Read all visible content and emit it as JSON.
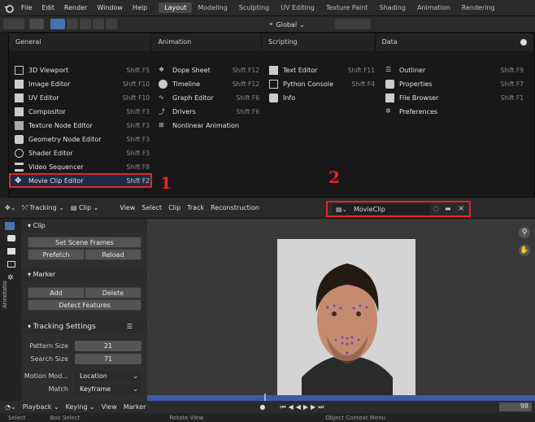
{
  "menubar": {
    "items": [
      "File",
      "Edit",
      "Render",
      "Window",
      "Help"
    ],
    "workspaces": [
      "Layout",
      "Modeling",
      "Sculpting",
      "UV Editing",
      "Texture Paint",
      "Shading",
      "Animation",
      "Rendering"
    ],
    "active_workspace": "Layout"
  },
  "toolbar": {
    "transform_orientation": "Global"
  },
  "editor_menu": {
    "columns": [
      "General",
      "Animation",
      "Scripting",
      "Data"
    ],
    "general": [
      {
        "label": "3D Viewport",
        "shortcut": "Shift F5"
      },
      {
        "label": "Image Editor",
        "shortcut": "Shift F10"
      },
      {
        "label": "UV Editor",
        "shortcut": "Shift F10"
      },
      {
        "label": "Compositor",
        "shortcut": "Shift F3"
      },
      {
        "label": "Texture Node Editor",
        "shortcut": "Shift F3"
      },
      {
        "label": "Geometry Node Editor",
        "shortcut": "Shift F3"
      },
      {
        "label": "Shader Editor",
        "shortcut": "Shift F3"
      },
      {
        "label": "Video Sequencer",
        "shortcut": "Shift F8"
      },
      {
        "label": "Movie Clip Editor",
        "shortcut": "Shift F2"
      }
    ],
    "animation": [
      {
        "label": "Dope Sheet",
        "shortcut": "Shift F12"
      },
      {
        "label": "Timeline",
        "shortcut": "Shift F12"
      },
      {
        "label": "Graph Editor",
        "shortcut": "Shift F6"
      },
      {
        "label": "Drivers",
        "shortcut": "Shift F6"
      },
      {
        "label": "Nonlinear Animation",
        "shortcut": ""
      }
    ],
    "scripting": [
      {
        "label": "Text Editor",
        "shortcut": "Shift F11"
      },
      {
        "label": "Python Console",
        "shortcut": "Shift F4"
      },
      {
        "label": "Info",
        "shortcut": ""
      }
    ],
    "data": [
      {
        "label": "Outliner",
        "shortcut": "Shift F9"
      },
      {
        "label": "Properties",
        "shortcut": "Shift F7"
      },
      {
        "label": "File Browser",
        "shortcut": "Shift F1"
      },
      {
        "label": "Preferences",
        "shortcut": ""
      }
    ]
  },
  "annotations": {
    "one": "1",
    "two": "2"
  },
  "clip_header": {
    "mode": "Tracking",
    "view_mode": "Clip",
    "menus": [
      "View",
      "Select",
      "Clip",
      "Track",
      "Reconstruction"
    ],
    "movieclip_name": "MovieClip"
  },
  "side_panel": {
    "clip_title": "Clip",
    "set_scene_frames": "Set Scene Frames",
    "prefetch": "Prefetch",
    "reload": "Reload",
    "marker_title": "Marker",
    "add": "Add",
    "delete": "Delete",
    "detect_features": "Detect Features",
    "tracking_settings_title": "Tracking Settings",
    "pattern_size_label": "Pattern Size",
    "pattern_size": "21",
    "search_size_label": "Search Size",
    "search_size": "71",
    "motion_model_label": "Motion Mod...",
    "motion_model": "Location",
    "match_label": "Match",
    "match": "Keyframe",
    "tab_label": "Annotatio"
  },
  "timeline": {
    "items": [
      "Playback",
      "Keying",
      "View",
      "Marker"
    ],
    "frame": "98"
  },
  "statusbar": {
    "select": "Select",
    "box_select": "Box Select",
    "rotate_view": "Rotate View",
    "context_menu": "Object Context Menu"
  },
  "colors": {
    "accent_blue": "#4772b3",
    "highlight_red": "#e8232b",
    "timeline_blue": "#3e59a8"
  }
}
